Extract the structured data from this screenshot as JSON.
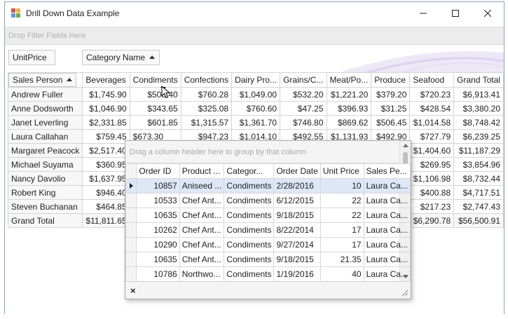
{
  "window": {
    "title": "Drill Down Data Example",
    "icon": "app-grid-icon",
    "controls": [
      "minimize-icon",
      "maximize-icon",
      "close-icon"
    ]
  },
  "filter_area": {
    "placeholder": "Drop Filter Fields Here"
  },
  "data_field": {
    "label": "UnitPrice"
  },
  "column_field": {
    "label": "Category Name"
  },
  "row_field": {
    "label": "Sales Person"
  },
  "pivot": {
    "columns": [
      "Beverages",
      "Condiments",
      "Confections",
      "Dairy Pro...",
      "Grains/C...",
      "Meat/Po...",
      "Produce",
      "Seafood",
      "Grand Total"
    ],
    "rows": [
      {
        "name": "Andrew Fuller",
        "values": [
          "$1,745.90",
          "$505.40",
          "$760.28",
          "$1,049.00",
          "$532.20",
          "$1,221.20",
          "$379.20",
          "$720.23",
          "$6,913.41"
        ]
      },
      {
        "name": "Anne Dodsworth",
        "values": [
          "$1,046.90",
          "$343.65",
          "$325.08",
          "$760.60",
          "$47.25",
          "$396.93",
          "$31.25",
          "$428.54",
          "$3,380.20"
        ]
      },
      {
        "name": "Janet Leverling",
        "values": [
          "$2,331.85",
          "$601.85",
          "$1,315.57",
          "$1,361.70",
          "$746.80",
          "$869.62",
          "$506.45",
          "$1,014.58",
          "$8,748.42"
        ]
      },
      {
        "name": "Laura Callahan",
        "values": [
          "$759.45",
          "$673.30",
          "$947.23",
          "$1,014.10",
          "$492.55",
          "$1,131.93",
          "$492.90",
          "$727.79",
          "$6,239.25"
        ]
      },
      {
        "name": "Margaret Peacock",
        "values": [
          "$2,517.40",
          "",
          "",
          "",
          "",
          "",
          "",
          "$1,404.60",
          "$11,187.29"
        ]
      },
      {
        "name": "Michael Suyama",
        "values": [
          "$360.95",
          "",
          "",
          "",
          "",
          "",
          "",
          "$269.95",
          "$3,854.96"
        ]
      },
      {
        "name": "Nancy Davolio",
        "values": [
          "$1,637.95",
          "",
          "",
          "",
          "",
          "",
          "",
          "$1,106.98",
          "$8,732.44"
        ]
      },
      {
        "name": "Robert King",
        "values": [
          "$946.40",
          "",
          "",
          "",
          "",
          "",
          "",
          "$400.88",
          "$4,717.51"
        ]
      },
      {
        "name": "Steven Buchanan",
        "values": [
          "$464.85",
          "",
          "",
          "",
          "",
          "",
          "",
          "$217.23",
          "$2,747.43"
        ]
      }
    ],
    "grand_total": {
      "name": "Grand Total",
      "values": [
        "$11,811.65",
        "",
        "",
        "",
        "",
        "",
        "",
        "$6,290.78",
        "$56,500.91"
      ]
    }
  },
  "drill_down": {
    "group_panel_placeholder": "Drag a column header here to group by that column",
    "columns": [
      "Order ID",
      "Product ...",
      "Categor...",
      "Order Date",
      "Unit Price",
      "Sales Pe..."
    ],
    "rows": [
      [
        "10857",
        "Aniseed ...",
        "Condiments",
        "2/28/2016",
        "10",
        "Laura Ca..."
      ],
      [
        "10533",
        "Chef Ant...",
        "Condiments",
        "6/12/2015",
        "22",
        "Laura Ca..."
      ],
      [
        "10635",
        "Chef Ant...",
        "Condiments",
        "9/18/2015",
        "22",
        "Laura Ca..."
      ],
      [
        "10262",
        "Chef Ant...",
        "Condiments",
        "8/22/2014",
        "17",
        "Laura Ca..."
      ],
      [
        "10290",
        "Chef Ant...",
        "Condiments",
        "9/27/2014",
        "17",
        "Laura Ca..."
      ],
      [
        "10635",
        "Chef Ant...",
        "Condiments",
        "9/18/2015",
        "21.35",
        "Laura Ca..."
      ],
      [
        "10786",
        "Northwo...",
        "Condiments",
        "1/19/2016",
        "40",
        "Laura Ca..."
      ]
    ],
    "close_label": "×"
  },
  "colors": {
    "selected_row": "#dde7f6",
    "border": "#8aa3c7",
    "filter_bg": "#ececec"
  }
}
